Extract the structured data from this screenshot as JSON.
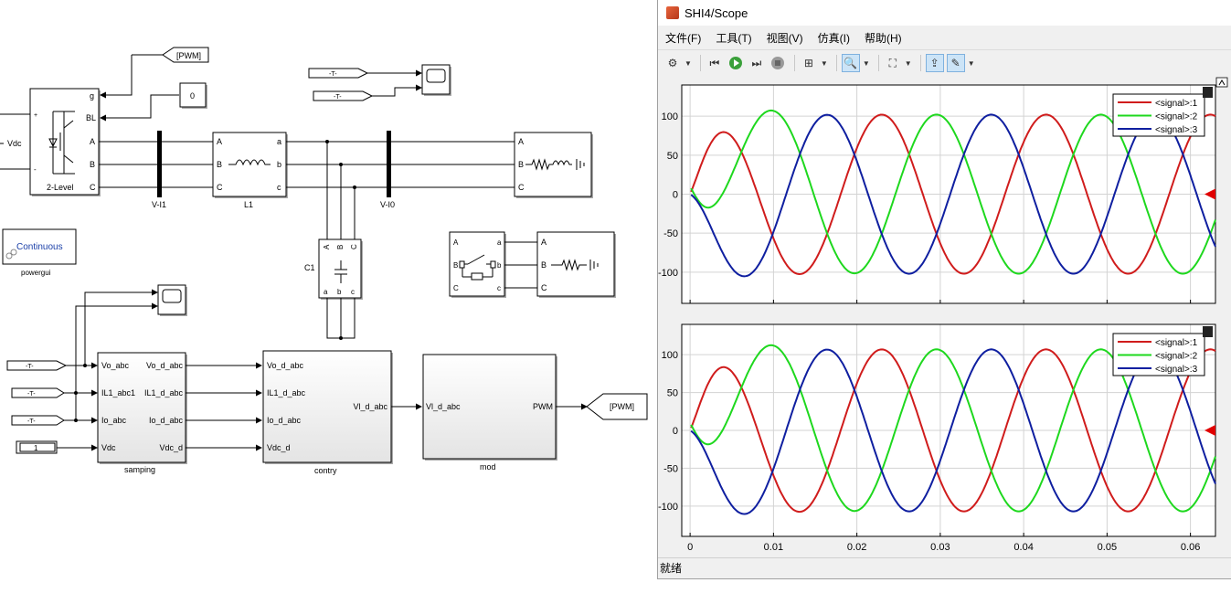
{
  "model": {
    "vdc_label": "Vdc",
    "vdc_plus": "+",
    "vdc_minus": "-",
    "inverter": {
      "name": "2-Level",
      "ports_in": [
        "+",
        "-"
      ],
      "ports_out": [
        "g",
        "BL",
        "A",
        "B",
        "C"
      ]
    },
    "pwm_goto": "[PWM]",
    "pwm_from": "[PWM]",
    "const_zero": "0",
    "const_one": "1",
    "from_tag": "-T-",
    "vi1": "V-I1",
    "vi0": "V-I0",
    "l1": {
      "name": "L1",
      "ports_in": [
        "A",
        "B",
        "C"
      ],
      "ports_out": [
        "a",
        "b",
        "c"
      ]
    },
    "c1": {
      "name": "C1",
      "ports_top": [
        "A",
        "B",
        "C"
      ],
      "ports_bottom": [
        "a",
        "b",
        "c"
      ]
    },
    "load_ports": [
      "A",
      "B",
      "C"
    ],
    "breaker_ports_in": [
      "A",
      "B",
      "C"
    ],
    "breaker_ports_out": [
      "a",
      "b",
      "c"
    ],
    "powergui": {
      "label": "Continuous",
      "name": "powergui"
    },
    "samping": {
      "name": "samping",
      "inputs": [
        "Vo_abc",
        "IL1_abc1",
        "Io_abc",
        "Vdc"
      ],
      "outputs": [
        "Vo_d_abc",
        "IL1_d_abc",
        "Io_d_abc",
        "Vdc_d"
      ]
    },
    "contry": {
      "name": "contry",
      "inputs": [
        "Vo_d_abc",
        "IL1_d_abc",
        "Io_d_abc",
        "Vdc_d"
      ],
      "output": "Vl_d_abc"
    },
    "mod": {
      "name": "mod",
      "input": "Vl_d_abc",
      "output": "PWM"
    }
  },
  "scope": {
    "title": "SHI4/Scope",
    "menu": [
      "文件(F)",
      "工具(T)",
      "视图(V)",
      "仿真(I)",
      "帮助(H)"
    ],
    "status": "就绪",
    "colors": {
      "signal1": "#d01c1c",
      "signal2": "#1ed81e",
      "signal3": "#0f1fa0"
    },
    "legend": [
      "<signal>:1",
      "<signal>:2",
      "<signal>:3"
    ],
    "toolbar_icons": [
      "gear-icon",
      "step-back-icon",
      "run-icon",
      "step-forward-icon",
      "stop-icon",
      "signal-select-icon",
      "zoom-icon",
      "fit-icon",
      "highlight-icon",
      "edit-icon"
    ]
  },
  "chart_data": [
    {
      "type": "line",
      "xlim": [
        -0.001,
        0.063
      ],
      "ylim": [
        -140,
        140
      ],
      "yticks": [
        100,
        50,
        0,
        -50,
        -100
      ],
      "ytick_labels": [
        "100",
        "50",
        "0",
        "-50",
        "-100"
      ],
      "grid": true,
      "legend": "top-right",
      "series": [
        {
          "name": "<signal>:1",
          "peak_x": 0.004,
          "peak_y": 87,
          "amplitude": 102,
          "period": 0.0197,
          "phase_deg": 0
        },
        {
          "name": "<signal>:2",
          "peak_x": 0.0088,
          "peak_y": 112,
          "amplitude": 102,
          "period": 0.0197,
          "phase_deg": 120
        },
        {
          "name": "<signal>:3",
          "trough_x": 0.0056,
          "trough_y": -113,
          "amplitude": 102,
          "period": 0.0197,
          "phase_deg": 240
        }
      ]
    },
    {
      "type": "line",
      "xlim": [
        -0.001,
        0.063
      ],
      "ylim": [
        -140,
        140
      ],
      "xticks": [
        0,
        0.01,
        0.02,
        0.03,
        0.04,
        0.05,
        0.06
      ],
      "xtick_labels": [
        "0",
        "0.01",
        "0.02",
        "0.03",
        "0.04",
        "0.05",
        "0.06"
      ],
      "yticks": [
        100,
        50,
        0,
        -50,
        -100
      ],
      "ytick_labels": [
        "100",
        "50",
        "0",
        "-50",
        "-100"
      ],
      "grid": true,
      "legend": "top-right",
      "series": [
        {
          "name": "<signal>:1",
          "peak_x": 0.005,
          "peak_y": 86,
          "amplitude": 107,
          "period": 0.0197,
          "phase_deg": 0
        },
        {
          "name": "<signal>:2",
          "peak_x": 0.0098,
          "peak_y": 116,
          "amplitude": 107,
          "period": 0.0197,
          "phase_deg": 120
        },
        {
          "name": "<signal>:3",
          "trough_x": 0.0068,
          "trough_y": -116,
          "amplitude": 107,
          "period": 0.0197,
          "phase_deg": 240
        }
      ]
    }
  ]
}
